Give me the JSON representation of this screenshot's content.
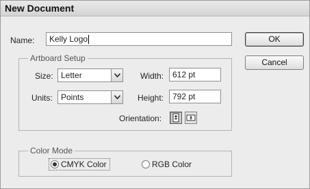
{
  "window": {
    "title": "New Document"
  },
  "name": {
    "label": "Name:",
    "value": "Kelly Logo"
  },
  "buttons": {
    "ok": "OK",
    "cancel": "Cancel"
  },
  "artboard": {
    "legend": "Artboard Setup",
    "size_label": "Size:",
    "size_value": "Letter",
    "units_label": "Units:",
    "units_value": "Points",
    "width_label": "Width:",
    "width_value": "612 pt",
    "height_label": "Height:",
    "height_value": "792 pt",
    "orientation_label": "Orientation:",
    "orientation_selected": "portrait"
  },
  "color_mode": {
    "legend": "Color Mode",
    "options": [
      "CMYK Color",
      "RGB Color"
    ],
    "selected": "CMYK Color"
  }
}
